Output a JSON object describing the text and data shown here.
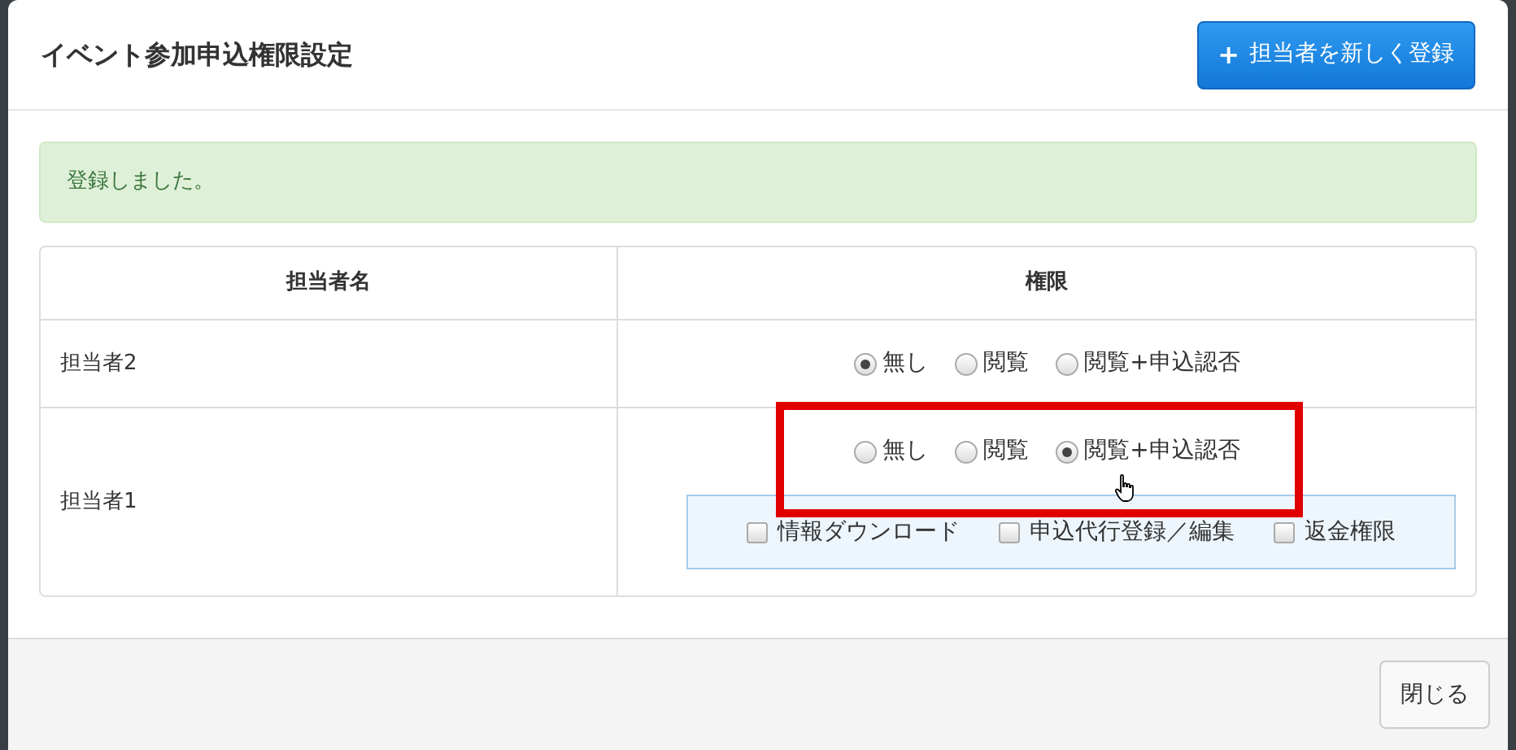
{
  "dialog": {
    "title": "イベント参加申込権限設定",
    "add_button": {
      "icon": "+",
      "label": "担当者を新しく登録"
    }
  },
  "alert": "登録しました。",
  "table": {
    "columns": [
      "担当者名",
      "権限"
    ],
    "rows": [
      {
        "name": "担当者2",
        "highlighted": false,
        "options": [
          {
            "label": "無し",
            "selected": true
          },
          {
            "label": "閲覧",
            "selected": false
          },
          {
            "label": "閲覧+申込認否",
            "selected": false
          }
        ]
      },
      {
        "name": "担当者1",
        "highlighted": true,
        "options": [
          {
            "label": "無し",
            "selected": false
          },
          {
            "label": "閲覧",
            "selected": false
          },
          {
            "label": "閲覧+申込認否",
            "selected": true
          }
        ],
        "extras": [
          {
            "label": "情報ダウンロード",
            "checked": false
          },
          {
            "label": "申込代行登録／編集",
            "checked": false
          },
          {
            "label": "返金権限",
            "checked": false
          }
        ]
      }
    ]
  },
  "footer": {
    "close_button": "閉じる"
  }
}
